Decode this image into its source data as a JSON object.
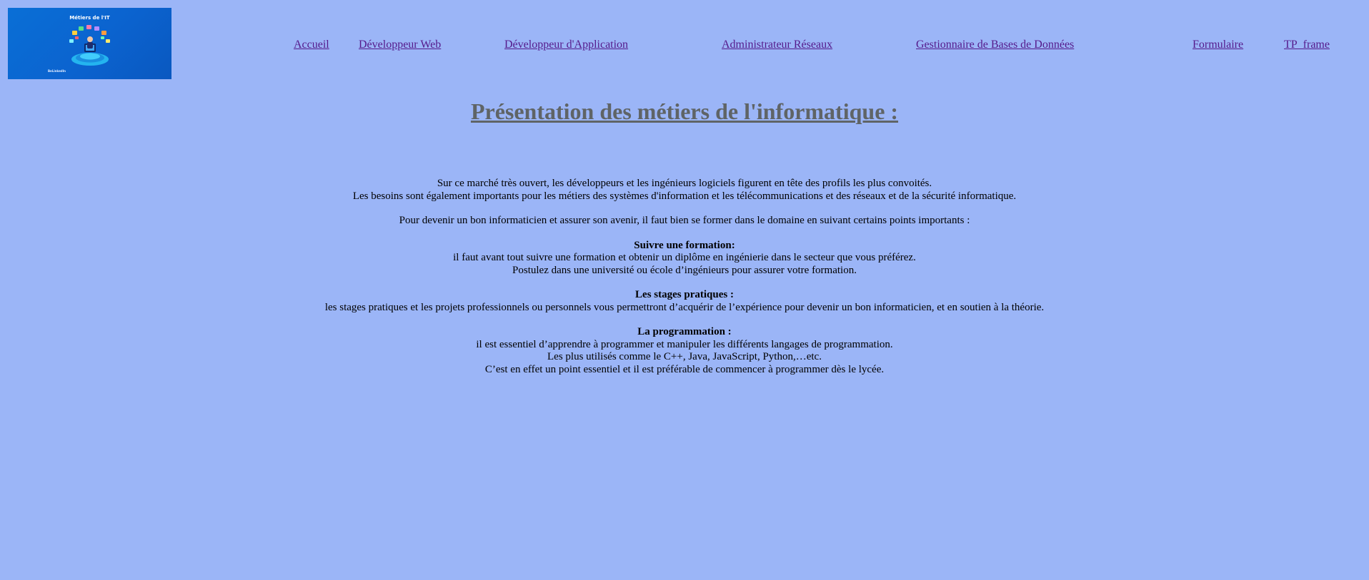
{
  "logo": {
    "title": "Métiers de l'IT",
    "brand": "BeLinkedIn"
  },
  "nav": {
    "accueil": "Accueil",
    "developpeur_web": "Développeur Web",
    "developpeur_application": "Développeur d'Application",
    "administrateur_reseaux": "Administrateur Réseaux",
    "gestionnaire_bdd": "Gestionnaire de Bases de Données",
    "formulaire": "Formulaire",
    "tp_frame": "TP_frame"
  },
  "heading": "Présentation des métiers de l'informatique :",
  "intro": {
    "line1": "Sur ce marché très ouvert, les développeurs et les ingénieurs logiciels figurent en tête des profils les plus convoités.",
    "line2": "Les besoins sont également importants pour les métiers des systèmes d'information et les télécommunications et des réseaux et de la sécurité informatique.",
    "line3": "Pour devenir un bon informaticien et assurer son avenir, il faut bien se former dans le domaine en suivant certains points importants :"
  },
  "sections": {
    "formation": {
      "title": "Suivre une formation:",
      "line1": "il faut avant tout suivre une formation et obtenir un diplôme en ingénierie dans le secteur que vous préférez.",
      "line2": "Postulez dans une université ou école d’ingénieurs pour assurer votre formation."
    },
    "stages": {
      "title": "Les stages pratiques :",
      "line1": "les stages pratiques et les projets professionnels ou personnels vous permettront d’acquérir de l’expérience pour devenir un bon informaticien, et en soutien à la théorie."
    },
    "programmation": {
      "title": "La programmation :",
      "line1": "il est essentiel d’apprendre à programmer et manipuler les différents langages de programmation.",
      "line2": "Les plus utilisés comme le C++, Java, JavaScript, Python,…etc.",
      "line3": "C’est en effet un point essentiel et il est préférable de commencer à programmer dès le lycée."
    }
  },
  "colors": {
    "background": "#9bb5f7",
    "link_visited": "#551a8b",
    "heading": "#5f6466",
    "logo_blue": "#0a6fd6"
  }
}
